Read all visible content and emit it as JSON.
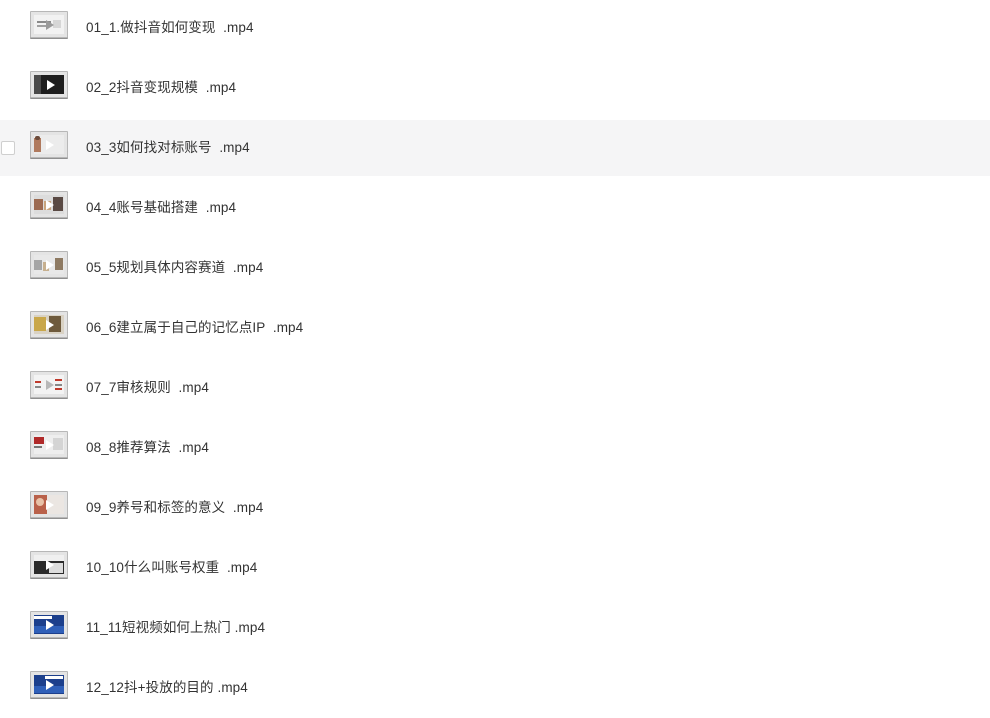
{
  "files": [
    {
      "name": "01_1.做抖音如何变现  .mp4",
      "thumb": "slide-light"
    },
    {
      "name": "02_2抖音变现规模  .mp4",
      "thumb": "dark-play"
    },
    {
      "name": "03_3如何找对标账号  .mp4",
      "thumb": "person-light"
    },
    {
      "name": "04_4账号基础搭建  .mp4",
      "thumb": "photo-collage"
    },
    {
      "name": "05_5规划具体内容赛道  .mp4",
      "thumb": "photo-collage-light"
    },
    {
      "name": "06_6建立属于自己的记忆点IP  .mp4",
      "thumb": "photo-warm"
    },
    {
      "name": "07_7审核规则  .mp4",
      "thumb": "diagram-light"
    },
    {
      "name": "08_8推荐算法  .mp4",
      "thumb": "slide-red"
    },
    {
      "name": "09_9养号和标签的意义  .mp4",
      "thumb": "person-face"
    },
    {
      "name": "10_10什么叫账号权重  .mp4",
      "thumb": "screen-dark"
    },
    {
      "name": "11_11短视频如何上热门 .mp4",
      "thumb": "blue-slide"
    },
    {
      "name": "12_12抖+投放的目的 .mp4",
      "thumb": "blue-slide"
    }
  ],
  "hovered_index": 2,
  "colors": {
    "row_hover": "#f5f5f6",
    "text": "#333333",
    "thumb_border": "#b7b7b7"
  }
}
